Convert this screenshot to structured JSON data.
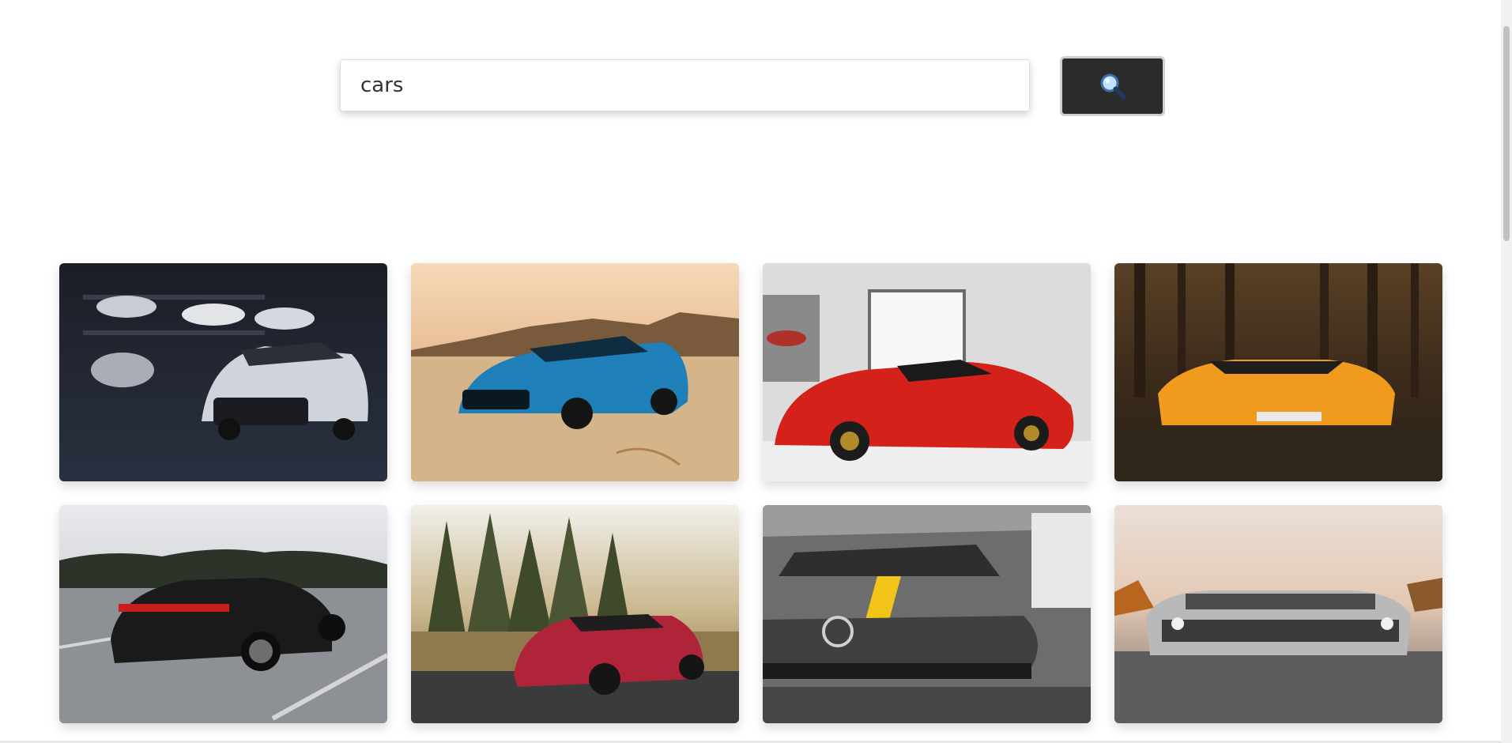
{
  "search": {
    "value": "cars",
    "button_icon": "magnifying-glass-icon"
  },
  "results": [
    {
      "subject": "white-camaro-in-dark-garage"
    },
    {
      "subject": "blue-camaro-in-desert"
    },
    {
      "subject": "red-laferrari-in-showroom"
    },
    {
      "subject": "orange-lamborghini-in-forest"
    },
    {
      "subject": "black-porsche-panamera-on-highway"
    },
    {
      "subject": "red-mercedes-amg-gt-by-trees"
    },
    {
      "subject": "grey-mercedes-with-yellow-stripe"
    },
    {
      "subject": "silver-dodge-challenger-at-sunset"
    }
  ],
  "colors": {
    "button_bg": "#2b2b2b",
    "input_border": "#dcdcdc"
  }
}
